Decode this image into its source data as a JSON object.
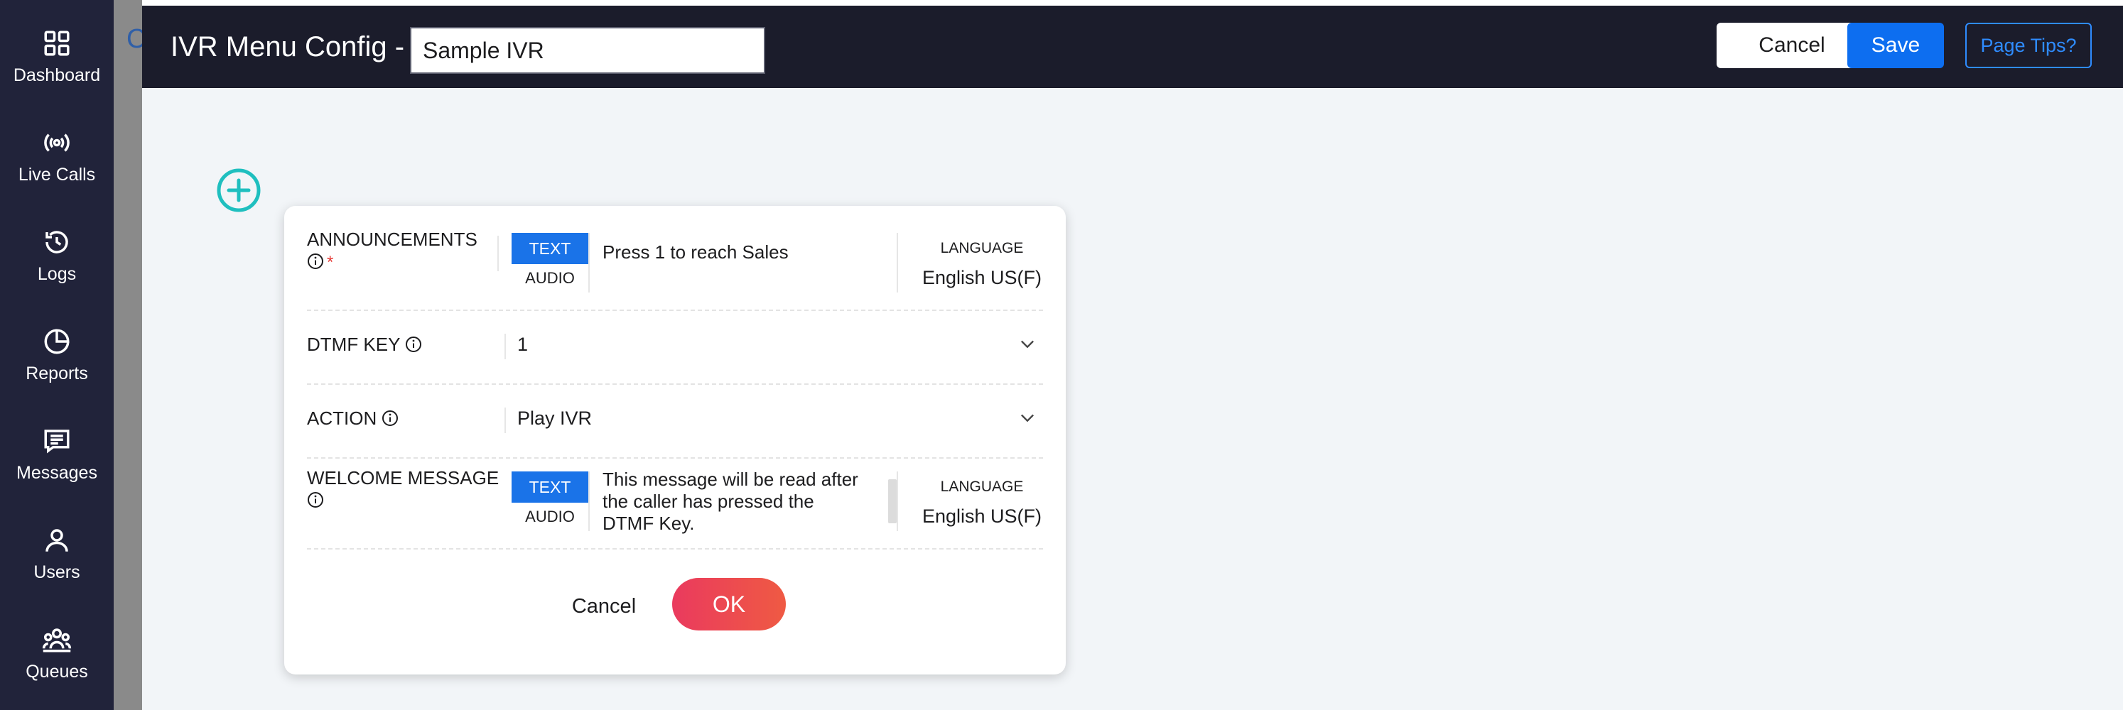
{
  "sidebar": {
    "items": [
      {
        "label": "Dashboard",
        "icon": "grid-icon"
      },
      {
        "label": "Live Calls",
        "icon": "broadcast-icon"
      },
      {
        "label": "Logs",
        "icon": "history-icon"
      },
      {
        "label": "Reports",
        "icon": "pie-chart-icon"
      },
      {
        "label": "Messages",
        "icon": "message-icon"
      },
      {
        "label": "Users",
        "icon": "user-icon"
      },
      {
        "label": "Queues",
        "icon": "group-icon"
      }
    ]
  },
  "background": {
    "peek_letter": "C"
  },
  "header": {
    "title": "IVR Menu Config -",
    "ivr_name_value": "Sample IVR",
    "cancel_label": "Cancel",
    "save_label": "Save",
    "tips_label": "Page Tips?"
  },
  "colors": {
    "nav_bg": "#21233a",
    "header_bg": "#1b1c2b",
    "primary_blue": "#0d6ef0",
    "text_toggle_active": "#1a73e8",
    "add_icon": "#1fbfbf",
    "ok_gradient_start": "#ea3a5e",
    "ok_gradient_end": "#ef5a43",
    "required_star": "#e53935"
  },
  "dialog": {
    "announcements": {
      "label": "ANNOUNCEMENTS",
      "required_mark": "*",
      "text_tab": "TEXT",
      "audio_tab": "AUDIO",
      "message": "Press 1 to reach Sales",
      "language_label": "LANGUAGE",
      "language_value": "English US(F)"
    },
    "dtmf": {
      "label": "DTMF KEY",
      "value": "1"
    },
    "action": {
      "label": "ACTION",
      "value": "Play IVR"
    },
    "welcome": {
      "label": "WELCOME MESSAGE",
      "text_tab": "TEXT",
      "audio_tab": "AUDIO",
      "message_lines": [
        "This message will be read after",
        "the caller has pressed the",
        "DTMF Key."
      ],
      "language_label": "LANGUAGE",
      "language_value": "English US(F)"
    },
    "cancel_label": "Cancel",
    "ok_label": "OK"
  }
}
